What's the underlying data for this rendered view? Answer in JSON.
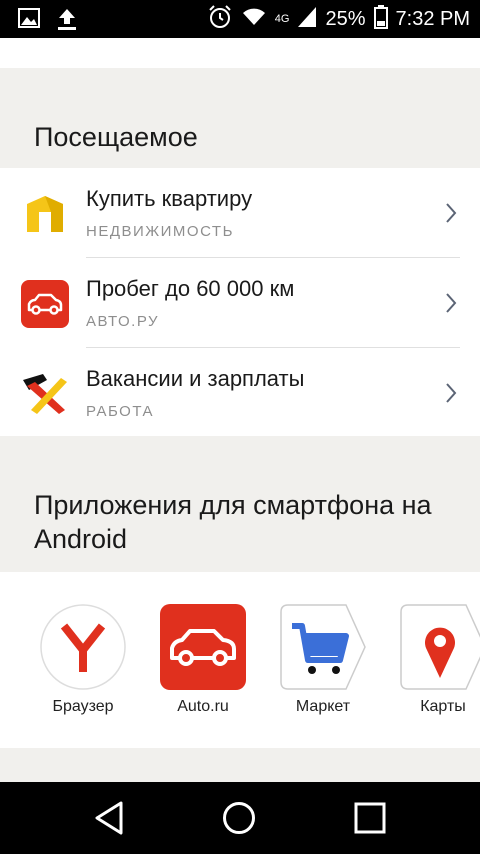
{
  "status_bar": {
    "network_label": "4G",
    "battery": "25%",
    "time": "7:32 PM"
  },
  "visited": {
    "title": "Посещаемое",
    "items": [
      {
        "title": "Купить квартиру",
        "subtitle": "НЕДВИЖИМОСТЬ",
        "icon": "realty-icon",
        "color": "#f5c518"
      },
      {
        "title": "Пробег до 60 000 км",
        "subtitle": "АВТО.РУ",
        "icon": "car-icon",
        "color": "#e0301e"
      },
      {
        "title": "Вакансии и зарплаты",
        "subtitle": "РАБОТА",
        "icon": "jobs-icon",
        "color": "#f5c518"
      }
    ]
  },
  "apps": {
    "title": "Приложения для смартфона на Android",
    "items": [
      {
        "label": "Браузер",
        "icon": "yandex-browser-icon",
        "color": "#e0301e"
      },
      {
        "label": "Auto.ru",
        "icon": "auto-ru-icon",
        "color": "#e0301e"
      },
      {
        "label": "Маркет",
        "icon": "market-icon",
        "color": "#3b6fd8"
      },
      {
        "label": "Карты",
        "icon": "maps-icon",
        "color": "#e0301e"
      }
    ]
  }
}
